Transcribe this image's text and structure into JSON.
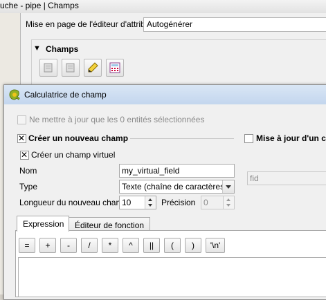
{
  "background": {
    "title": "uche - pipe | Champs",
    "editor_label": "Mise en page de l'éditeur d'attribut",
    "editor_value": "Autogénérer",
    "group_title": "Champs"
  },
  "dialog": {
    "title": "Calculatrice de champ",
    "update_selected_label": "Ne mettre à jour que les 0 entités sélectionnées",
    "create_field_label": "Créer un nouveau champ",
    "update_existing_label": "Mise à jour d'un ch",
    "virtual_field_label": "Créer un champ virtuel",
    "name_label": "Nom",
    "name_value": "my_virtual_field",
    "type_label": "Type",
    "type_value": "Texte (chaîne de caractères)",
    "length_label": "Longueur du nouveau champ",
    "length_value": "10",
    "precision_label": "Précision",
    "precision_value": "0",
    "existing_field_value": "fid",
    "tabs": [
      {
        "label": "Expression"
      },
      {
        "label": "Éditeur de fonction"
      }
    ],
    "operators": [
      "=",
      "+",
      "-",
      "/",
      "*",
      "^",
      "||",
      "(",
      ")",
      "'\\n'"
    ]
  },
  "colors": {
    "title_bar": "#c3d6ee",
    "dialog_bg": "#f0f0f0"
  }
}
